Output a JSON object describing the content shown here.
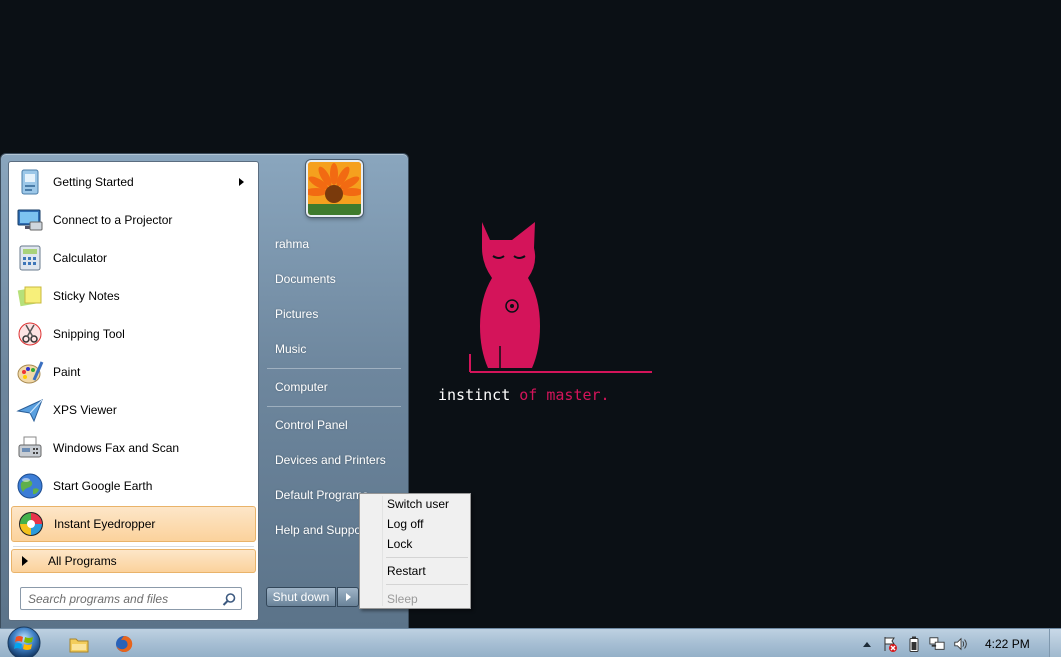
{
  "desktop": {
    "tagline_part1": "instinct",
    "tagline_part2": "of master.",
    "accent_color": "#d4145a"
  },
  "start_menu": {
    "programs": [
      {
        "label": "Getting Started",
        "icon": "getting-started-icon",
        "has_submenu": true
      },
      {
        "label": "Connect to a Projector",
        "icon": "projector-icon",
        "has_submenu": false
      },
      {
        "label": "Calculator",
        "icon": "calculator-icon",
        "has_submenu": false
      },
      {
        "label": "Sticky Notes",
        "icon": "sticky-notes-icon",
        "has_submenu": false
      },
      {
        "label": "Snipping Tool",
        "icon": "snipping-tool-icon",
        "has_submenu": false
      },
      {
        "label": "Paint",
        "icon": "paint-icon",
        "has_submenu": false
      },
      {
        "label": "XPS Viewer",
        "icon": "xps-viewer-icon",
        "has_submenu": false
      },
      {
        "label": "Windows Fax and Scan",
        "icon": "fax-scan-icon",
        "has_submenu": false
      },
      {
        "label": "Start Google Earth",
        "icon": "google-earth-icon",
        "has_submenu": false
      },
      {
        "label": "Instant Eyedropper",
        "icon": "eyedropper-icon",
        "has_submenu": false,
        "highlighted": true
      }
    ],
    "all_programs_label": "All Programs",
    "search_placeholder": "Search programs and files",
    "right_items": {
      "user": "rahma",
      "documents": "Documents",
      "pictures": "Pictures",
      "music": "Music",
      "computer": "Computer",
      "control_panel": "Control Panel",
      "devices_printers": "Devices and Printers",
      "default_programs": "Default Programs",
      "help_support": "Help and Support"
    },
    "shutdown_label": "Shut down",
    "highlight_color": "#fbd29c"
  },
  "power_menu": {
    "switch_user": "Switch user",
    "log_off": "Log off",
    "lock": "Lock",
    "restart": "Restart",
    "sleep": "Sleep"
  },
  "taskbar": {
    "pinned": [
      "windows-explorer-icon",
      "firefox-icon"
    ],
    "tray": [
      "show-hidden-icons",
      "action-center-icon",
      "battery-icon",
      "network-icon",
      "volume-icon"
    ],
    "clock": "4:22 PM"
  }
}
